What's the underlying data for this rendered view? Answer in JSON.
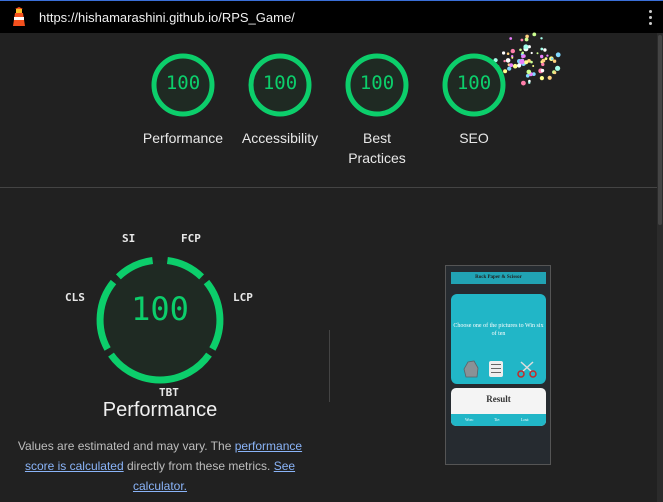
{
  "browser": {
    "url": "https://hishamarashini.github.io/RPS_Game/"
  },
  "categories": [
    {
      "score": "100",
      "label": "Performance"
    },
    {
      "score": "100",
      "label": "Accessibility"
    },
    {
      "score": "100",
      "label": "Best Practices"
    },
    {
      "score": "100",
      "label": "SEO"
    }
  ],
  "performance": {
    "score": "100",
    "title": "Performance",
    "metrics": {
      "si": "SI",
      "fcp": "FCP",
      "lcp": "LCP",
      "tbt": "TBT",
      "cls": "CLS"
    },
    "desc_pre": "Values are estimated and may vary. The ",
    "desc_link1": "performance score is calculated",
    "desc_mid": " directly from these metrics. ",
    "desc_link2": "See calculator."
  },
  "thumbnail": {
    "header": "Rock Paper & Scissor",
    "card_text": "Choose one of the pictures to Win six of ten",
    "result_title": "Result",
    "result_win": "Won:",
    "result_tie": "Tie:",
    "result_lost": "Lost:"
  },
  "colors": {
    "pass_green": "#0cce6b",
    "background": "#212121",
    "link": "#8ab4f8",
    "thumb_accent": "#21b6c7"
  },
  "icons": {
    "logo": "lighthouse-icon",
    "menu": "more-vert-icon"
  }
}
